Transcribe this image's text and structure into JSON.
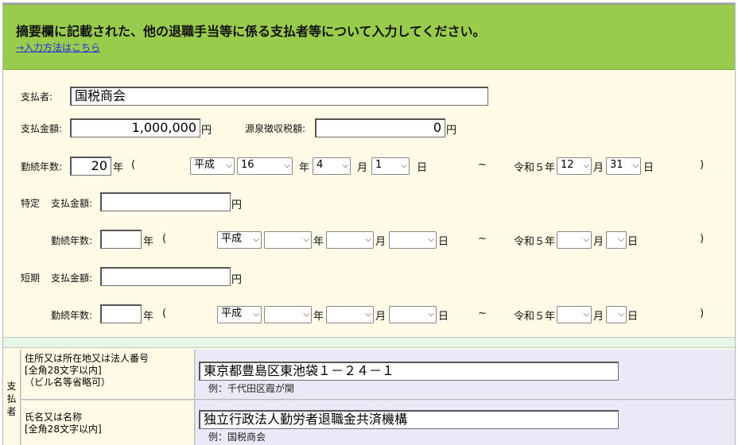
{
  "header": {
    "title": "摘要欄に記載された、他の退職手当等に係る支払者等について入力してください。",
    "link": "→入力方法はこちら"
  },
  "payer": {
    "label": "支払者:",
    "value": "国税商会"
  },
  "payment": {
    "amount_label": "支払金額:",
    "amount_value": "1,000,000",
    "yen": "円",
    "withholding_label": "源泉徴収税額:",
    "withholding_value": "0"
  },
  "service": {
    "label": "勤続年数:",
    "years_value": "20",
    "year_unit": "年",
    "paren_open": "(",
    "paren_close": ")",
    "era": "平成",
    "start_year": "16",
    "start_month": "4",
    "start_day": "1",
    "month_unit": "月",
    "day_unit": "日",
    "tilde": "~",
    "end_era_text": "令和５年",
    "end_month": "12",
    "end_day": "31"
  },
  "specific": {
    "section_label": "特定",
    "amount_label": "支払金額:",
    "amount_value": "",
    "service_label": "勤続年数:",
    "years_value": "",
    "era": "平成",
    "start_year": "",
    "start_month": "",
    "start_day": "",
    "end_era_text": "令和５年",
    "end_month": "",
    "end_day": ""
  },
  "short": {
    "section_label": "短期",
    "amount_label": "支払金額:",
    "amount_value": "",
    "service_label": "勤続年数:",
    "years_value": "",
    "era": "平成",
    "start_year": "",
    "start_month": "",
    "start_day": "",
    "end_era_text": "令和５年",
    "end_month": "",
    "end_day": ""
  },
  "payer_table": {
    "side_label": [
      "支",
      "払",
      "者"
    ],
    "address_label_1": "住所又は所在地又は法人番号",
    "address_label_2": "[全角28文字以内]",
    "address_label_3": "（ビル名等省略可）",
    "address_value": "東京都豊島区東池袋１－２４－１",
    "address_hint": "例：千代田区霞が関",
    "name_label_1": "氏名又は名称",
    "name_label_2": "[全角28文字以内]",
    "name_value": "独立行政法人勤労者退職金共済機構",
    "name_hint": "例：国税商会"
  }
}
